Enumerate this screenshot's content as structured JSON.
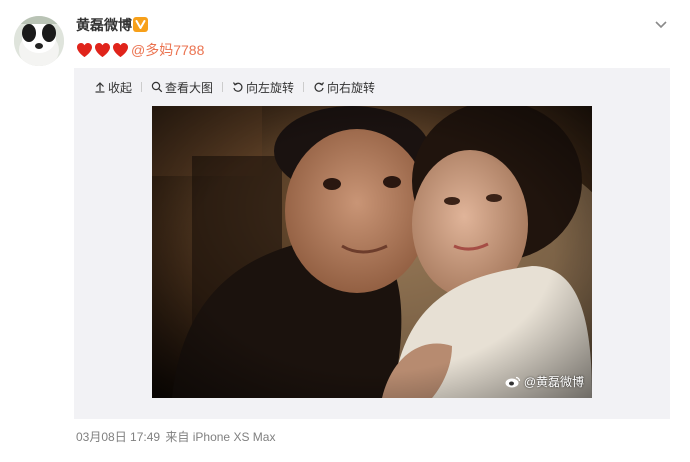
{
  "post": {
    "author": "黄磊微博",
    "text_mention": "@多妈7788",
    "timestamp": "03月08日 17:49",
    "source": "来自 iPhone XS Max",
    "hearts": 3
  },
  "toolbar": {
    "collapse": "收起",
    "view_large": "查看大图",
    "rotate_left": "向左旋转",
    "rotate_right": "向右旋转"
  },
  "photo": {
    "watermark": "@黄磊微博"
  },
  "icons": {
    "avatar": "panda-dog-avatar-icon",
    "verified": "verified-badge-icon",
    "more": "chevron-down-icon",
    "heart": "red-heart-icon",
    "weibo": "weibo-logo-icon"
  },
  "colors": {
    "mention": "#eb7350",
    "verified": "#f7a01a",
    "media_bg": "#f2f2f5",
    "meta": "#808080"
  }
}
